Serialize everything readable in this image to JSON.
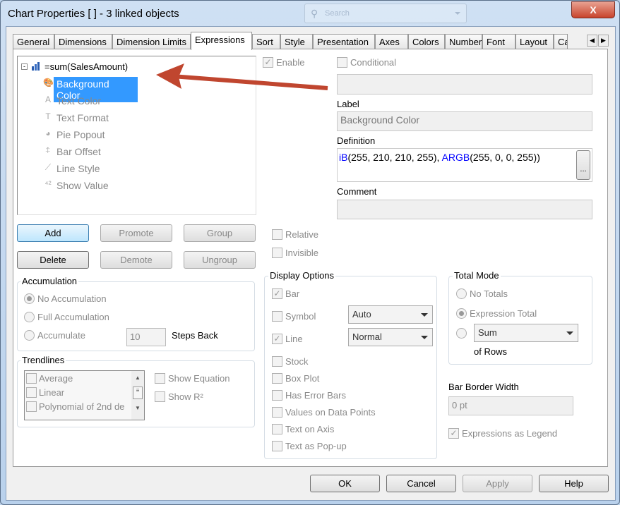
{
  "window": {
    "title": "Chart Properties [ ] - 3 linked objects",
    "close": "X",
    "search_placeholder": "Search"
  },
  "tabs": [
    "General",
    "Dimensions",
    "Dimension Limits",
    "Expressions",
    "Sort",
    "Style",
    "Presentation",
    "Axes",
    "Colors",
    "Number",
    "Font",
    "Layout",
    "Ca"
  ],
  "active_tab": "Expressions",
  "tree": {
    "root": "=sum(SalesAmount)",
    "children": [
      {
        "label": "Background Color",
        "icon": "palette-icon",
        "selected": true
      },
      {
        "label": "Text Color",
        "icon": "letter-a-icon"
      },
      {
        "label": "Text Format",
        "icon": "letter-t-icon"
      },
      {
        "label": "Pie Popout",
        "icon": "pie-icon"
      },
      {
        "label": "Bar Offset",
        "icon": "bar-offset-icon"
      },
      {
        "label": "Line Style",
        "icon": "line-style-icon"
      },
      {
        "label": "Show Value",
        "icon": "show-value-icon"
      }
    ]
  },
  "buttons": {
    "add": "Add",
    "promote": "Promote",
    "group": "Group",
    "delete": "Delete",
    "demote": "Demote",
    "ungroup": "Ungroup"
  },
  "accumulation": {
    "title": "Accumulation",
    "options": [
      "No Accumulation",
      "Full Accumulation",
      "Accumulate"
    ],
    "selected": "No Accumulation",
    "steps": "10",
    "steps_label": "Steps Back"
  },
  "trendlines": {
    "title": "Trendlines",
    "items": [
      "Average",
      "Linear",
      "Polynomial of 2nd de"
    ],
    "show_equation": "Show Equation",
    "show_r2": "Show R²"
  },
  "right": {
    "enable": "Enable",
    "conditional": "Conditional",
    "label_title": "Label",
    "label_value": "Background Color",
    "definition_title": "Definition",
    "definition_value": "iB(255, 210, 210, 255), ARGB(255, 0, 0, 255))",
    "definition_btn": "...",
    "comment_title": "Comment",
    "relative": "Relative",
    "invisible": "Invisible"
  },
  "display_options": {
    "title": "Display Options",
    "bar": "Bar",
    "symbol": "Symbol",
    "symbol_value": "Auto",
    "line": "Line",
    "line_value": "Normal",
    "others": [
      "Stock",
      "Box Plot",
      "Has Error Bars",
      "Values on Data Points",
      "Text on Axis",
      "Text as Pop-up"
    ]
  },
  "total_mode": {
    "title": "Total Mode",
    "no_totals": "No Totals",
    "expression_total": "Expression Total",
    "sum": "Sum",
    "of_rows": "of Rows",
    "selected": "Expression Total"
  },
  "bar_border": {
    "title": "Bar Border Width",
    "value": "0 pt"
  },
  "expressions_as_legend": "Expressions as Legend",
  "footer": {
    "ok": "OK",
    "cancel": "Cancel",
    "apply": "Apply",
    "help": "Help"
  },
  "colors": {
    "selection": "#3399ff",
    "arrow": "#c0462f",
    "keyword": "#0000ff"
  }
}
